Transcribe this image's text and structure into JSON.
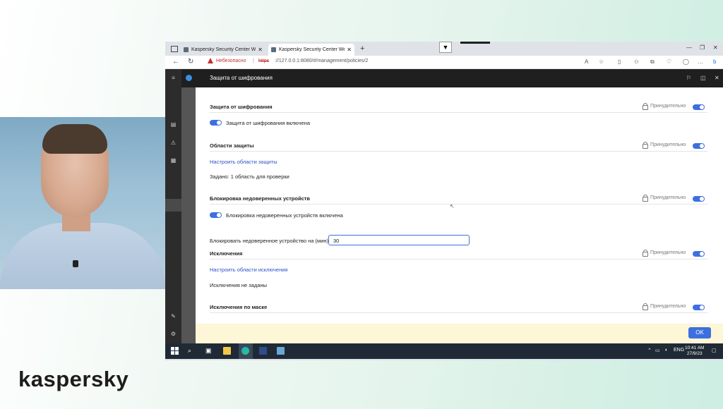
{
  "brand": {
    "logo_text": "kaspersky"
  },
  "browser": {
    "tabs": [
      {
        "title": "Kaspersky Security Center Web C"
      },
      {
        "title": "Kaspersky Security Center Web C"
      }
    ],
    "new_tab": "+",
    "dropdown": "▼",
    "address": {
      "warning": "Небезопасно",
      "separator": "|",
      "scheme": "https",
      "rest": "://127.0.0.1:8080/#/management/policies/2"
    }
  },
  "panel": {
    "title": "Защита от шифрования"
  },
  "sections": {
    "encryption": {
      "title": "Защита от шифрования",
      "enforced": "Принудительно",
      "toggle_label": "Защита от шифрования включена"
    },
    "scopes": {
      "title": "Области защиты",
      "enforced": "Принудительно",
      "link": "Настроить области защиты",
      "summary": "Задано: 1 область для проверки"
    },
    "blocking": {
      "title": "Блокировка недоверенных устройств",
      "enforced": "Принудительно",
      "toggle_label": "Блокировка недоверенных устройств включена",
      "duration_label": "Блокировать недоверенное устройство на (мин):",
      "duration_value": "30"
    },
    "exclusions": {
      "title": "Исключения",
      "enforced": "Принудительно",
      "link": "Настроить области исключения",
      "summary": "Исключения не заданы"
    },
    "mask_exclusions": {
      "title": "Исключения по маске",
      "enforced": "Принудительно"
    }
  },
  "footer": {
    "ok_label": "OK"
  },
  "taskbar": {
    "language": "ENG",
    "time": "10:41 AM",
    "date": "27/9/23"
  },
  "colors": {
    "accent": "#3d6fe0",
    "link": "#2b4fc9",
    "header": "#1f1f1f",
    "footer": "#fdf6d7",
    "warning": "#c4302b"
  }
}
